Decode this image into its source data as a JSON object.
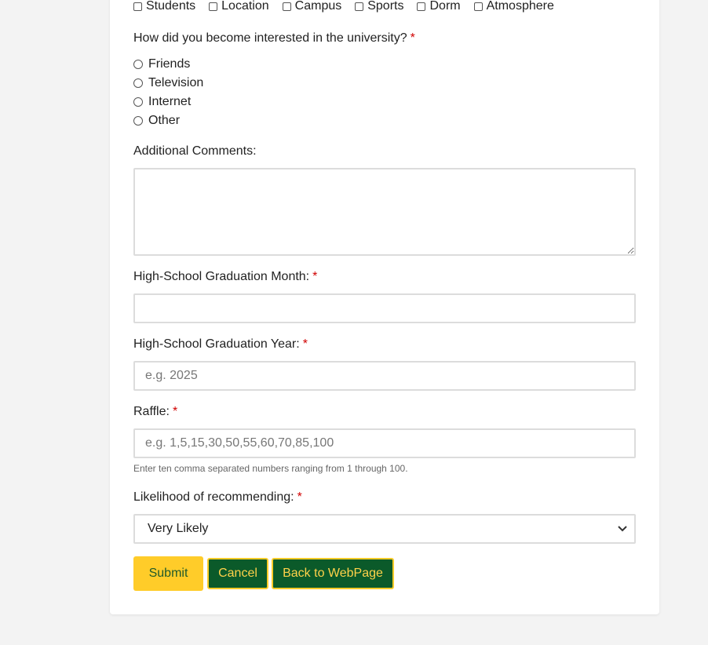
{
  "interests": {
    "options": [
      "Students",
      "Location",
      "Campus",
      "Sports",
      "Dorm",
      "Atmosphere"
    ]
  },
  "interest_source": {
    "question": "How did you become interested in the university?",
    "required_mark": "*",
    "options": [
      "Friends",
      "Television",
      "Internet",
      "Other"
    ]
  },
  "comments": {
    "label": "Additional Comments:",
    "value": ""
  },
  "grad_month": {
    "label": "High-School Graduation Month:",
    "required_mark": "*",
    "value": ""
  },
  "grad_year": {
    "label": "High-School Graduation Year:",
    "required_mark": "*",
    "placeholder": "e.g. 2025"
  },
  "raffle": {
    "label": "Raffle:",
    "required_mark": "*",
    "placeholder": "e.g. 1,5,15,30,50,55,60,70,85,100",
    "help": "Enter ten comma separated numbers ranging from 1 through 100."
  },
  "recommend": {
    "label": "Likelihood of recommending:",
    "required_mark": "*",
    "selected": "Very Likely"
  },
  "buttons": {
    "submit": "Submit",
    "cancel": "Cancel",
    "back": "Back to WebPage"
  },
  "colors": {
    "primary_green": "#0b5a2a",
    "accent_gold": "#ffcc29",
    "required_red": "#d00000"
  }
}
